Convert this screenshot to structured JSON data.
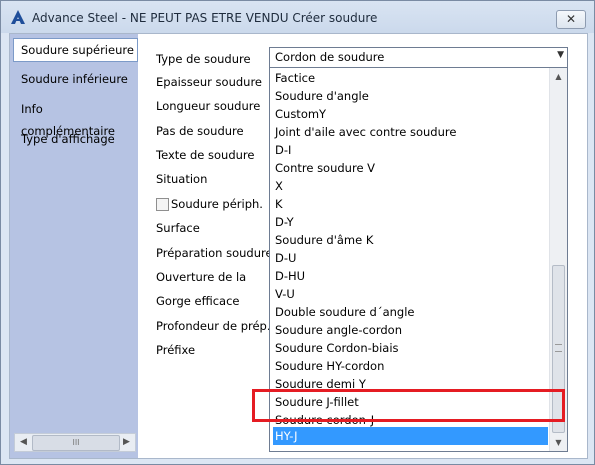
{
  "window": {
    "title": "Advance Steel - NE PEUT PAS ETRE VENDU   Créer soudure",
    "close_label": "✕",
    "colors": {
      "sidebar": "#b6c3e3",
      "selection": "#3399ff",
      "highlight": "#e51c23"
    }
  },
  "sidebar": {
    "items": [
      {
        "label": "Soudure supérieure",
        "active": true
      },
      {
        "label": "Soudure inférieure",
        "active": false
      },
      {
        "label": "Info complémentaire",
        "active": false
      },
      {
        "label": "Type d'affichage",
        "active": false
      }
    ],
    "scroll_thumb_glyph": "III"
  },
  "form": {
    "labels": {
      "type": "Type de soudure",
      "epaisseur": "Epaisseur soudure",
      "longueur": "Longueur soudure",
      "pas": "Pas de soudure",
      "texte": "Texte de soudure",
      "situation": "Situation",
      "surface": "Surface",
      "preparation": "Préparation soudure",
      "ouverture": "Ouverture de la",
      "gorge": "Gorge efficace",
      "profondeur": "Profondeur de prép.",
      "prefixe": "Préfixe"
    },
    "checkbox_label": "Soudure périph.",
    "combo_value": "Cordon de soudure"
  },
  "dropdown": {
    "options": [
      "Factice",
      "Soudure d'angle",
      "CustomY",
      "Joint d'aile avec contre soudure",
      "D-I",
      "Contre soudure V",
      "X",
      "K",
      "D-Y",
      "Soudure d'âme K",
      "D-U",
      "D-HU",
      "V-U",
      "Double soudure d´angle",
      "Soudure angle-cordon",
      "Soudure Cordon-biais",
      "Soudure HY-cordon",
      "Soudure demi Y",
      "Soudure J-fillet",
      "Soudure cordon-J",
      "HY-J"
    ],
    "selected": "HY-J"
  }
}
